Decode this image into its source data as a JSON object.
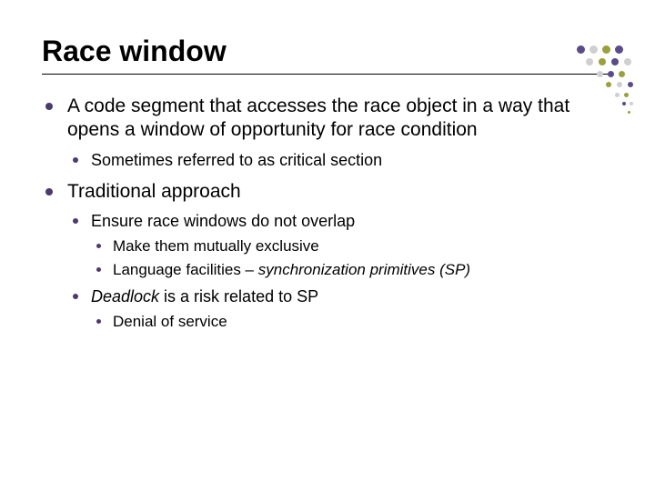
{
  "title": "Race window",
  "bullets": {
    "b1": "A code segment that accesses the race object in a way that opens a window of opportunity for race condition",
    "b1_1": "Sometimes referred to as critical section",
    "b2": "Traditional approach",
    "b2_1": "Ensure race windows do not overlap",
    "b2_1_1": "Make them mutually exclusive",
    "b2_1_2_pre": "Language facilities – ",
    "b2_1_2_em": "synchronization primitives (SP)",
    "b2_2_em": "Deadlock",
    "b2_2_post": " is a risk related to SP",
    "b2_2_1": "Denial of service"
  },
  "deco_colors": {
    "purple": "#5b4b8a",
    "olive": "#9aa03c",
    "gray": "#cfcfcf"
  }
}
